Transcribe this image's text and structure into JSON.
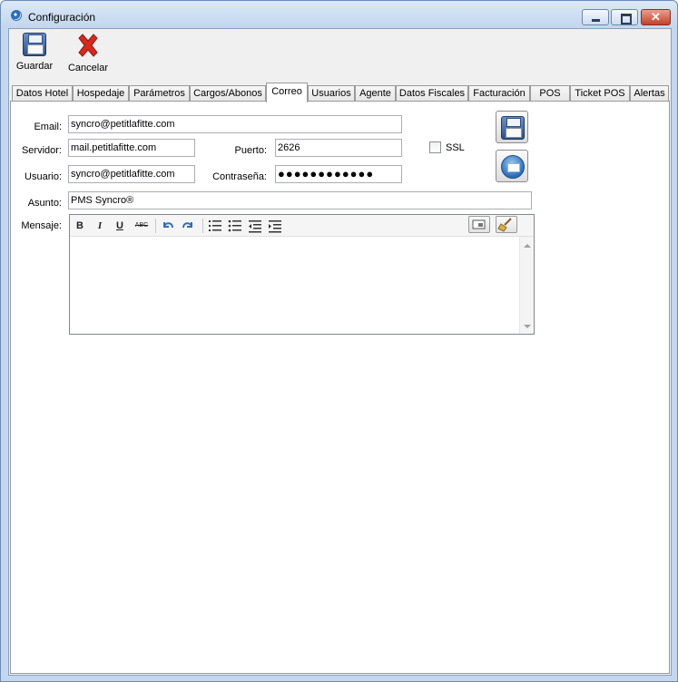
{
  "window": {
    "title": "Configuración"
  },
  "toolbar": {
    "save_label": "Guardar",
    "cancel_label": "Cancelar"
  },
  "tabs": [
    {
      "label": "Datos Hotel"
    },
    {
      "label": "Hospedaje"
    },
    {
      "label": "Parámetros"
    },
    {
      "label": "Cargos/Abonos"
    },
    {
      "label": "Correo"
    },
    {
      "label": "Usuarios"
    },
    {
      "label": "Agente"
    },
    {
      "label": "Datos Fiscales"
    },
    {
      "label": "Facturación"
    },
    {
      "label": "POS"
    },
    {
      "label": "Ticket POS"
    },
    {
      "label": "Alertas"
    }
  ],
  "active_tab": "Correo",
  "form": {
    "email_label": "Email:",
    "email_value": "syncro@petitlafitte.com",
    "server_label": "Servidor:",
    "server_value": "mail.petitlafitte.com",
    "port_label": "Puerto:",
    "port_value": "2626",
    "ssl_label": "SSL",
    "ssl_checked": false,
    "user_label": "Usuario:",
    "user_value": "syncro@petitlafitte.com",
    "password_label": "Contraseña:",
    "password_value": "●●●●●●●●●●●●",
    "subject_label": "Asunto:",
    "subject_value": "PMS Syncro®",
    "message_label": "Mensaje:",
    "message_value": ""
  },
  "editor_toolbar": {
    "bold": "B",
    "italic": "I",
    "underline": "U",
    "strike": "ABC"
  },
  "icons": {
    "save": "floppy-disk-icon",
    "cancel": "red-x-icon",
    "send_mail": "mail-icon",
    "undo": "undo-icon",
    "redo": "redo-icon"
  }
}
